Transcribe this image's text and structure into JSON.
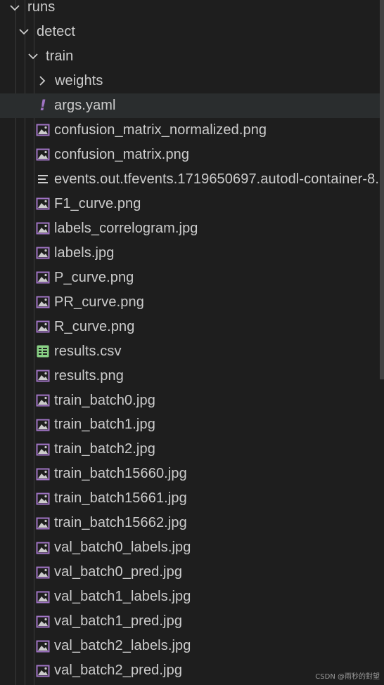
{
  "tree": {
    "items": [
      {
        "label": "runs",
        "type": "folder",
        "expanded": true,
        "depth": 0,
        "icon": "chevron-down-icon"
      },
      {
        "label": "detect",
        "type": "folder",
        "expanded": true,
        "depth": 1,
        "icon": "chevron-down-icon"
      },
      {
        "label": "train",
        "type": "folder",
        "expanded": true,
        "depth": 2,
        "icon": "chevron-down-icon"
      },
      {
        "label": "weights",
        "type": "folder",
        "expanded": false,
        "depth": 3,
        "icon": "chevron-right-icon"
      },
      {
        "label": "args.yaml",
        "type": "yaml",
        "depth": 3,
        "icon": "yaml-icon",
        "selected": true
      },
      {
        "label": "confusion_matrix_normalized.png",
        "type": "image",
        "depth": 3,
        "icon": "image-icon"
      },
      {
        "label": "confusion_matrix.png",
        "type": "image",
        "depth": 3,
        "icon": "image-icon"
      },
      {
        "label": "events.out.tfevents.1719650697.autodl-container-8...",
        "type": "text",
        "depth": 3,
        "icon": "text-file-icon"
      },
      {
        "label": "F1_curve.png",
        "type": "image",
        "depth": 3,
        "icon": "image-icon"
      },
      {
        "label": "labels_correlogram.jpg",
        "type": "image",
        "depth": 3,
        "icon": "image-icon"
      },
      {
        "label": "labels.jpg",
        "type": "image",
        "depth": 3,
        "icon": "image-icon"
      },
      {
        "label": "P_curve.png",
        "type": "image",
        "depth": 3,
        "icon": "image-icon"
      },
      {
        "label": "PR_curve.png",
        "type": "image",
        "depth": 3,
        "icon": "image-icon"
      },
      {
        "label": "R_curve.png",
        "type": "image",
        "depth": 3,
        "icon": "image-icon"
      },
      {
        "label": "results.csv",
        "type": "csv",
        "depth": 3,
        "icon": "csv-table-icon"
      },
      {
        "label": "results.png",
        "type": "image",
        "depth": 3,
        "icon": "image-icon"
      },
      {
        "label": "train_batch0.jpg",
        "type": "image",
        "depth": 3,
        "icon": "image-icon"
      },
      {
        "label": "train_batch1.jpg",
        "type": "image",
        "depth": 3,
        "icon": "image-icon"
      },
      {
        "label": "train_batch2.jpg",
        "type": "image",
        "depth": 3,
        "icon": "image-icon"
      },
      {
        "label": "train_batch15660.jpg",
        "type": "image",
        "depth": 3,
        "icon": "image-icon"
      },
      {
        "label": "train_batch15661.jpg",
        "type": "image",
        "depth": 3,
        "icon": "image-icon"
      },
      {
        "label": "train_batch15662.jpg",
        "type": "image",
        "depth": 3,
        "icon": "image-icon"
      },
      {
        "label": "val_batch0_labels.jpg",
        "type": "image",
        "depth": 3,
        "icon": "image-icon"
      },
      {
        "label": "val_batch0_pred.jpg",
        "type": "image",
        "depth": 3,
        "icon": "image-icon"
      },
      {
        "label": "val_batch1_labels.jpg",
        "type": "image",
        "depth": 3,
        "icon": "image-icon"
      },
      {
        "label": "val_batch1_pred.jpg",
        "type": "image",
        "depth": 3,
        "icon": "image-icon"
      },
      {
        "label": "val_batch2_labels.jpg",
        "type": "image",
        "depth": 3,
        "icon": "image-icon"
      },
      {
        "label": "val_batch2_pred.jpg",
        "type": "image",
        "depth": 3,
        "icon": "image-icon"
      }
    ]
  },
  "watermark": "CSDN @雨秒的對望",
  "colors": {
    "background": "#1e1e1e",
    "text": "#cccccc",
    "selected_row": "#2a2d2e",
    "image_icon": "#a074c4",
    "yaml_icon": "#a074c4",
    "csv_icon": "#89d185",
    "text_file_icon": "#cccccc",
    "indent_guide": "#3a3a3a",
    "scrollbar": "#424242"
  }
}
